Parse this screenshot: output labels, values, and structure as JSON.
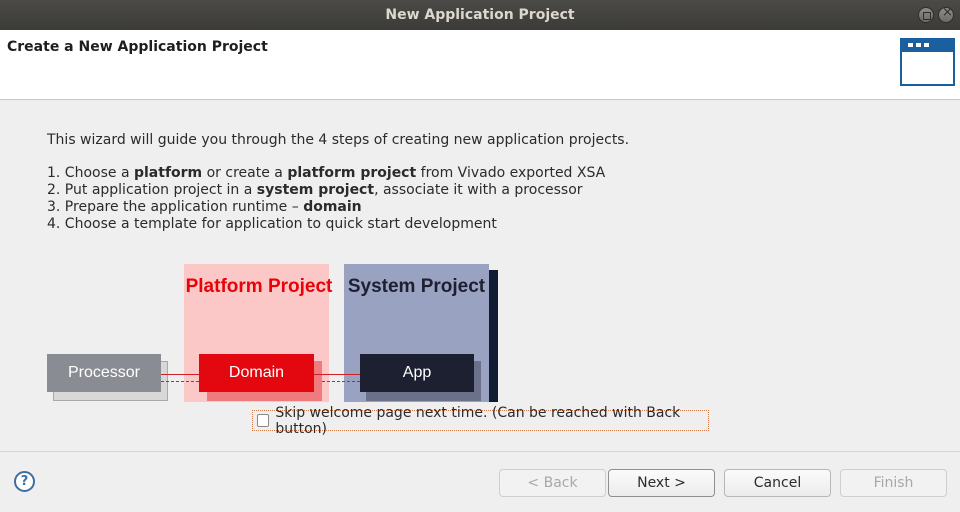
{
  "window": {
    "title": "New Application Project"
  },
  "header": {
    "page_title": "Create a New Application Project",
    "icon": "wizard-window-icon"
  },
  "content": {
    "intro": "This wizard will guide you through the 4 steps of creating new application projects.",
    "steps": [
      [
        {
          "t": "1.  Choose a "
        },
        {
          "t": "platform",
          "b": true
        },
        {
          "t": " or create a "
        },
        {
          "t": "platform project",
          "b": true
        },
        {
          "t": " from Vivado exported XSA"
        }
      ],
      [
        {
          "t": "2.  Put application project in a "
        },
        {
          "t": "system project",
          "b": true
        },
        {
          "t": ", associate it with a processor"
        }
      ],
      [
        {
          "t": "3.  Prepare the application runtime – "
        },
        {
          "t": "domain",
          "b": true
        }
      ],
      [
        {
          "t": "4.  Choose a template for application to quick start development"
        }
      ]
    ]
  },
  "diagram": {
    "platform_title": "Platform Project",
    "system_title": "System Project",
    "processor_label": "Processor",
    "domain_label": "Domain",
    "app_label": "App",
    "colors": {
      "platform_bg": "#fbc7c7",
      "platform_text": "#e5040a",
      "system_bg": "#9aa2c2",
      "domain": "#e3070f",
      "app": "#1c2030",
      "processor": "#8a8c93"
    }
  },
  "skip": {
    "label": "Skip welcome page next time. (Can be reached with Back button)",
    "checked": false
  },
  "footer": {
    "help_icon": "help-icon",
    "back_label": "< Back",
    "next_label": "Next >",
    "cancel_label": "Cancel",
    "finish_label": "Finish"
  }
}
